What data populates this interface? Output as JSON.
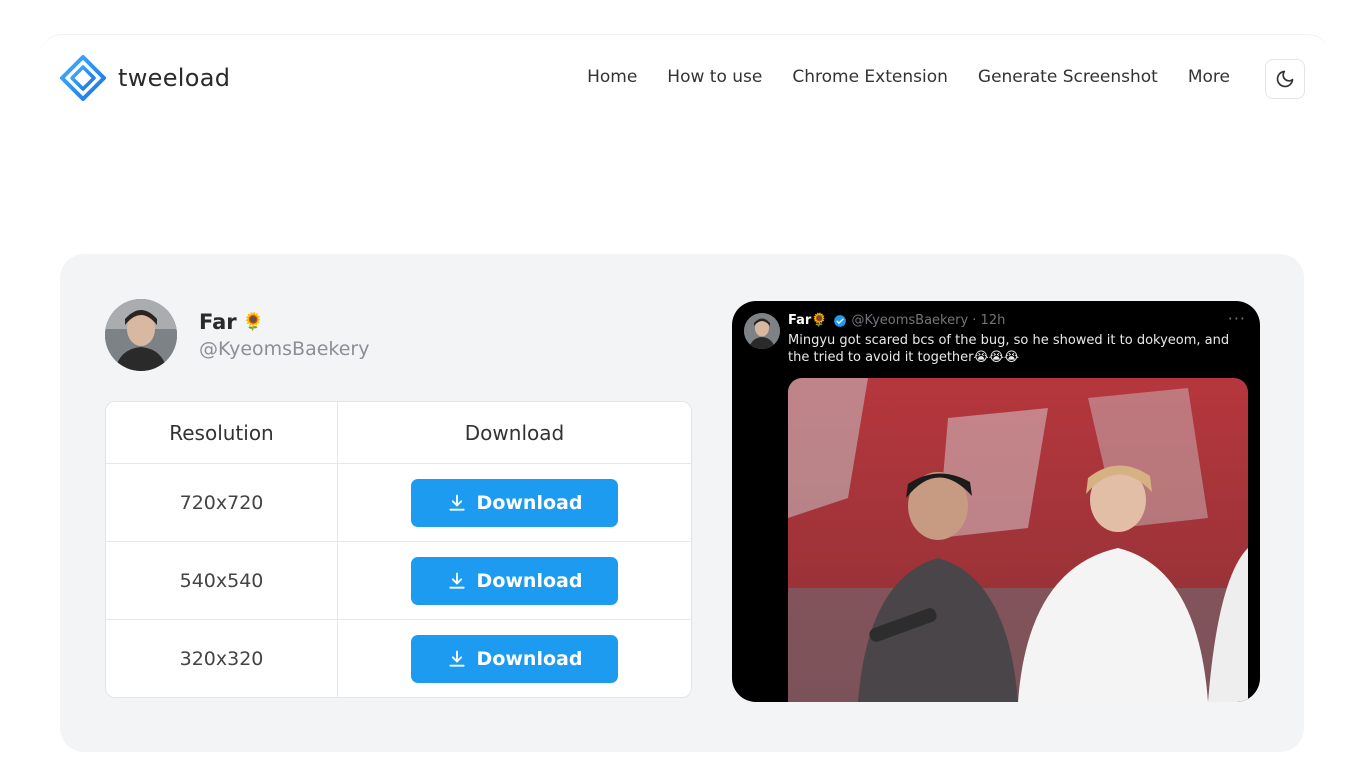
{
  "brand": {
    "name": "tweeload",
    "accent": "#1d9bf0"
  },
  "nav": {
    "items": [
      "Home",
      "How to use",
      "Chrome Extension",
      "Generate Screenshot",
      "More"
    ]
  },
  "theme_toggle": {
    "icon": "moon-icon"
  },
  "profile": {
    "name": "Far",
    "name_emoji": "🌻",
    "handle": "@KyeomsBaekery"
  },
  "table": {
    "headers": {
      "resolution": "Resolution",
      "download": "Download"
    },
    "rows": [
      {
        "resolution": "720x720",
        "button": "Download"
      },
      {
        "resolution": "540x540",
        "button": "Download"
      },
      {
        "resolution": "320x320",
        "button": "Download"
      }
    ]
  },
  "tweet": {
    "name": "Far🌻",
    "handle_time": "@KyeomsBaekery · 12h",
    "more": "···",
    "text": "Mingyu got scared bcs of the bug, so he showed it to dokyeom, and the tried to avoid it together😭😭😭"
  }
}
